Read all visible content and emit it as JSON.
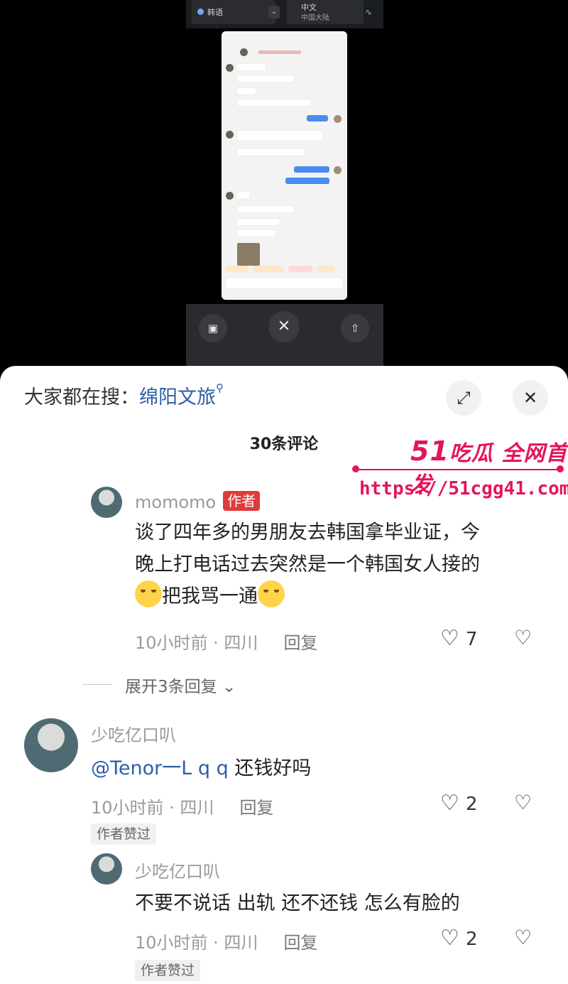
{
  "translator": {
    "source_lang": "韩语",
    "target_lang": "中文",
    "target_region": "中国大陆"
  },
  "sheet": {
    "search_prefix": "大家都在搜：",
    "search_keyword": "绵阳文旅",
    "comment_count": "30条评论"
  },
  "watermark": {
    "line1_num": "51",
    "line1_text": "吃瓜 全网首发",
    "line2": "https://51cgg41.com"
  },
  "comments": [
    {
      "username": "momomo",
      "author_tag": "作者",
      "text_line1": "谈了四年多的男朋友去韩国拿毕业证，今",
      "text_line2": "晚上打电话过去突然是一个韩国女人接的",
      "text_line3": "把我骂一通",
      "time_loc": "10小时前 · 四川",
      "reply_label": "回复",
      "likes": "7",
      "expand_label": "展开3条回复"
    },
    {
      "username": "少吃亿口叭",
      "mention": "@Tenor一L q q",
      "text": " 还钱好吗",
      "time_loc": "10小时前 · 四川",
      "reply_label": "回复",
      "likes": "2",
      "badge": "作者赞过"
    },
    {
      "username": "少吃亿口叭",
      "text": "不要不说话 出轨 还不还钱 怎么有脸的",
      "time_loc": "10小时前 · 四川",
      "reply_label": "回复",
      "likes": "2",
      "badge": "作者赞过"
    }
  ]
}
